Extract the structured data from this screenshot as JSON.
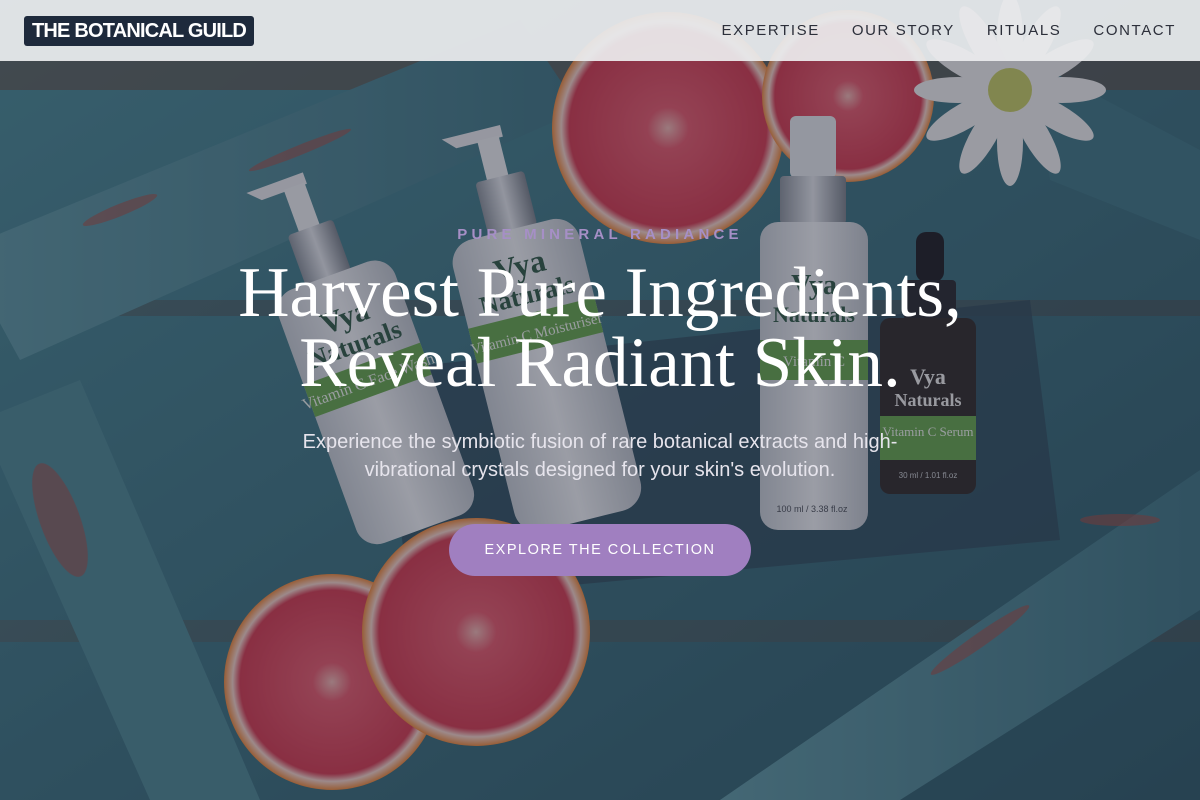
{
  "brand": {
    "name": "THE BOTANICAL GUILD"
  },
  "nav": {
    "items": [
      {
        "label": "EXPERTISE"
      },
      {
        "label": "OUR STORY"
      },
      {
        "label": "RITUALS"
      },
      {
        "label": "CONTACT"
      }
    ]
  },
  "hero": {
    "eyebrow": "PURE MINERAL RADIANCE",
    "headline_line1": "Harvest Pure Ingredients,",
    "headline_line2": "Reveal Radiant Skin.",
    "subtitle": "Experience the symbiotic fusion of rare botanical extracts and high-vibrational crystals designed for your skin's evolution.",
    "cta_label": "EXPLORE THE COLLECTION",
    "photo_labels": {
      "brand_line1": "Vya",
      "brand_line2": "Naturals",
      "product_1": "Vitamin C Face Wash",
      "product_2": "Vitamin C Moisturiser",
      "product_3": "Vitamin C",
      "product_4": "Vitamin C Serum",
      "volume_3": "100 ml / 3.38 fl.oz",
      "volume_4": "30 ml / 1.01 fl.oz"
    }
  },
  "colors": {
    "accent": "#a07fc0",
    "eyebrow": "#a68fc6",
    "logo_bg": "#1e2a3c",
    "nav_bg": "#ececee",
    "wood_teal": "#3f7f8a",
    "grapefruit": "#e5475a"
  }
}
